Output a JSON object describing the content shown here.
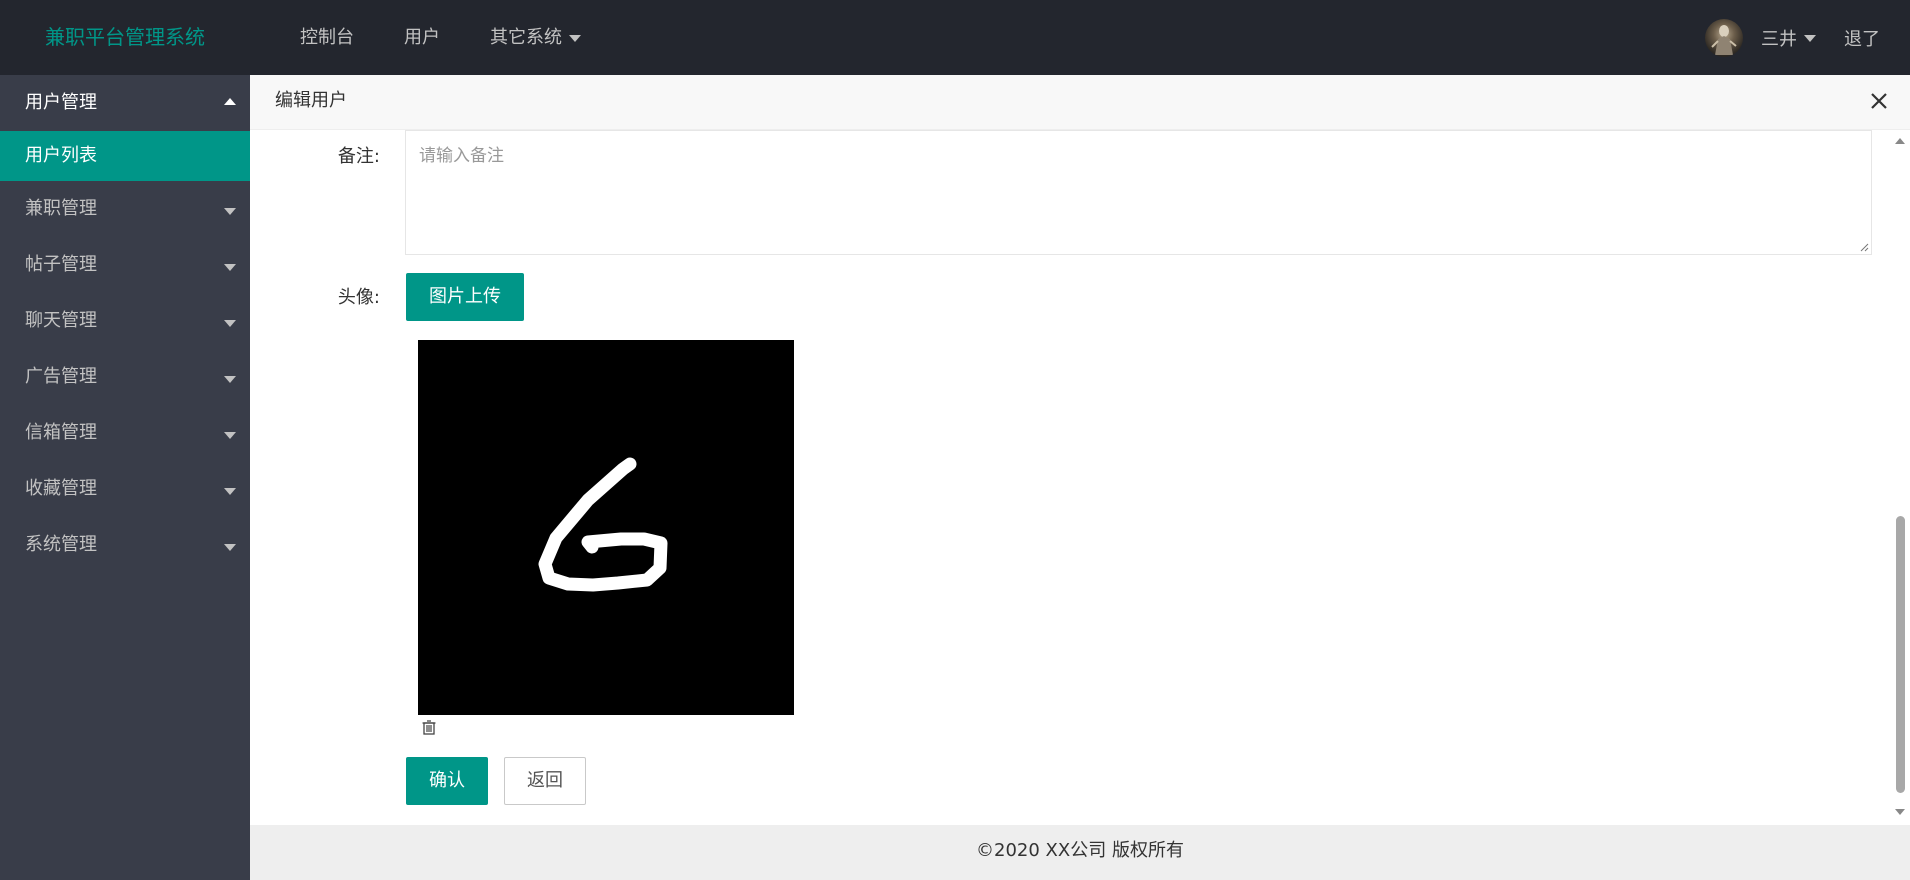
{
  "header": {
    "logo": "兼职平台管理系统",
    "nav": [
      {
        "label": "控制台"
      },
      {
        "label": "用户"
      },
      {
        "label": "其它系统"
      }
    ],
    "user_name": "三井",
    "logout": "退了"
  },
  "sidebar": {
    "open_group": "用户管理",
    "active_child": "用户列表",
    "groups": [
      "兼职管理",
      "帖子管理",
      "聊天管理",
      "广告管理",
      "信箱管理",
      "收藏管理",
      "系统管理"
    ]
  },
  "panel": {
    "title": "编辑用户"
  },
  "form": {
    "remark_label": "备注:",
    "remark_placeholder": "请输入备注",
    "avatar_label": "头像:",
    "upload_button": "图片上传",
    "confirm_button": "确认",
    "back_button": "返回"
  },
  "footer": {
    "copyright": "©2020 XX公司 版权所有"
  },
  "colors": {
    "accent": "#009688",
    "header_bg": "#23262e",
    "sidebar_bg": "#393d49"
  }
}
